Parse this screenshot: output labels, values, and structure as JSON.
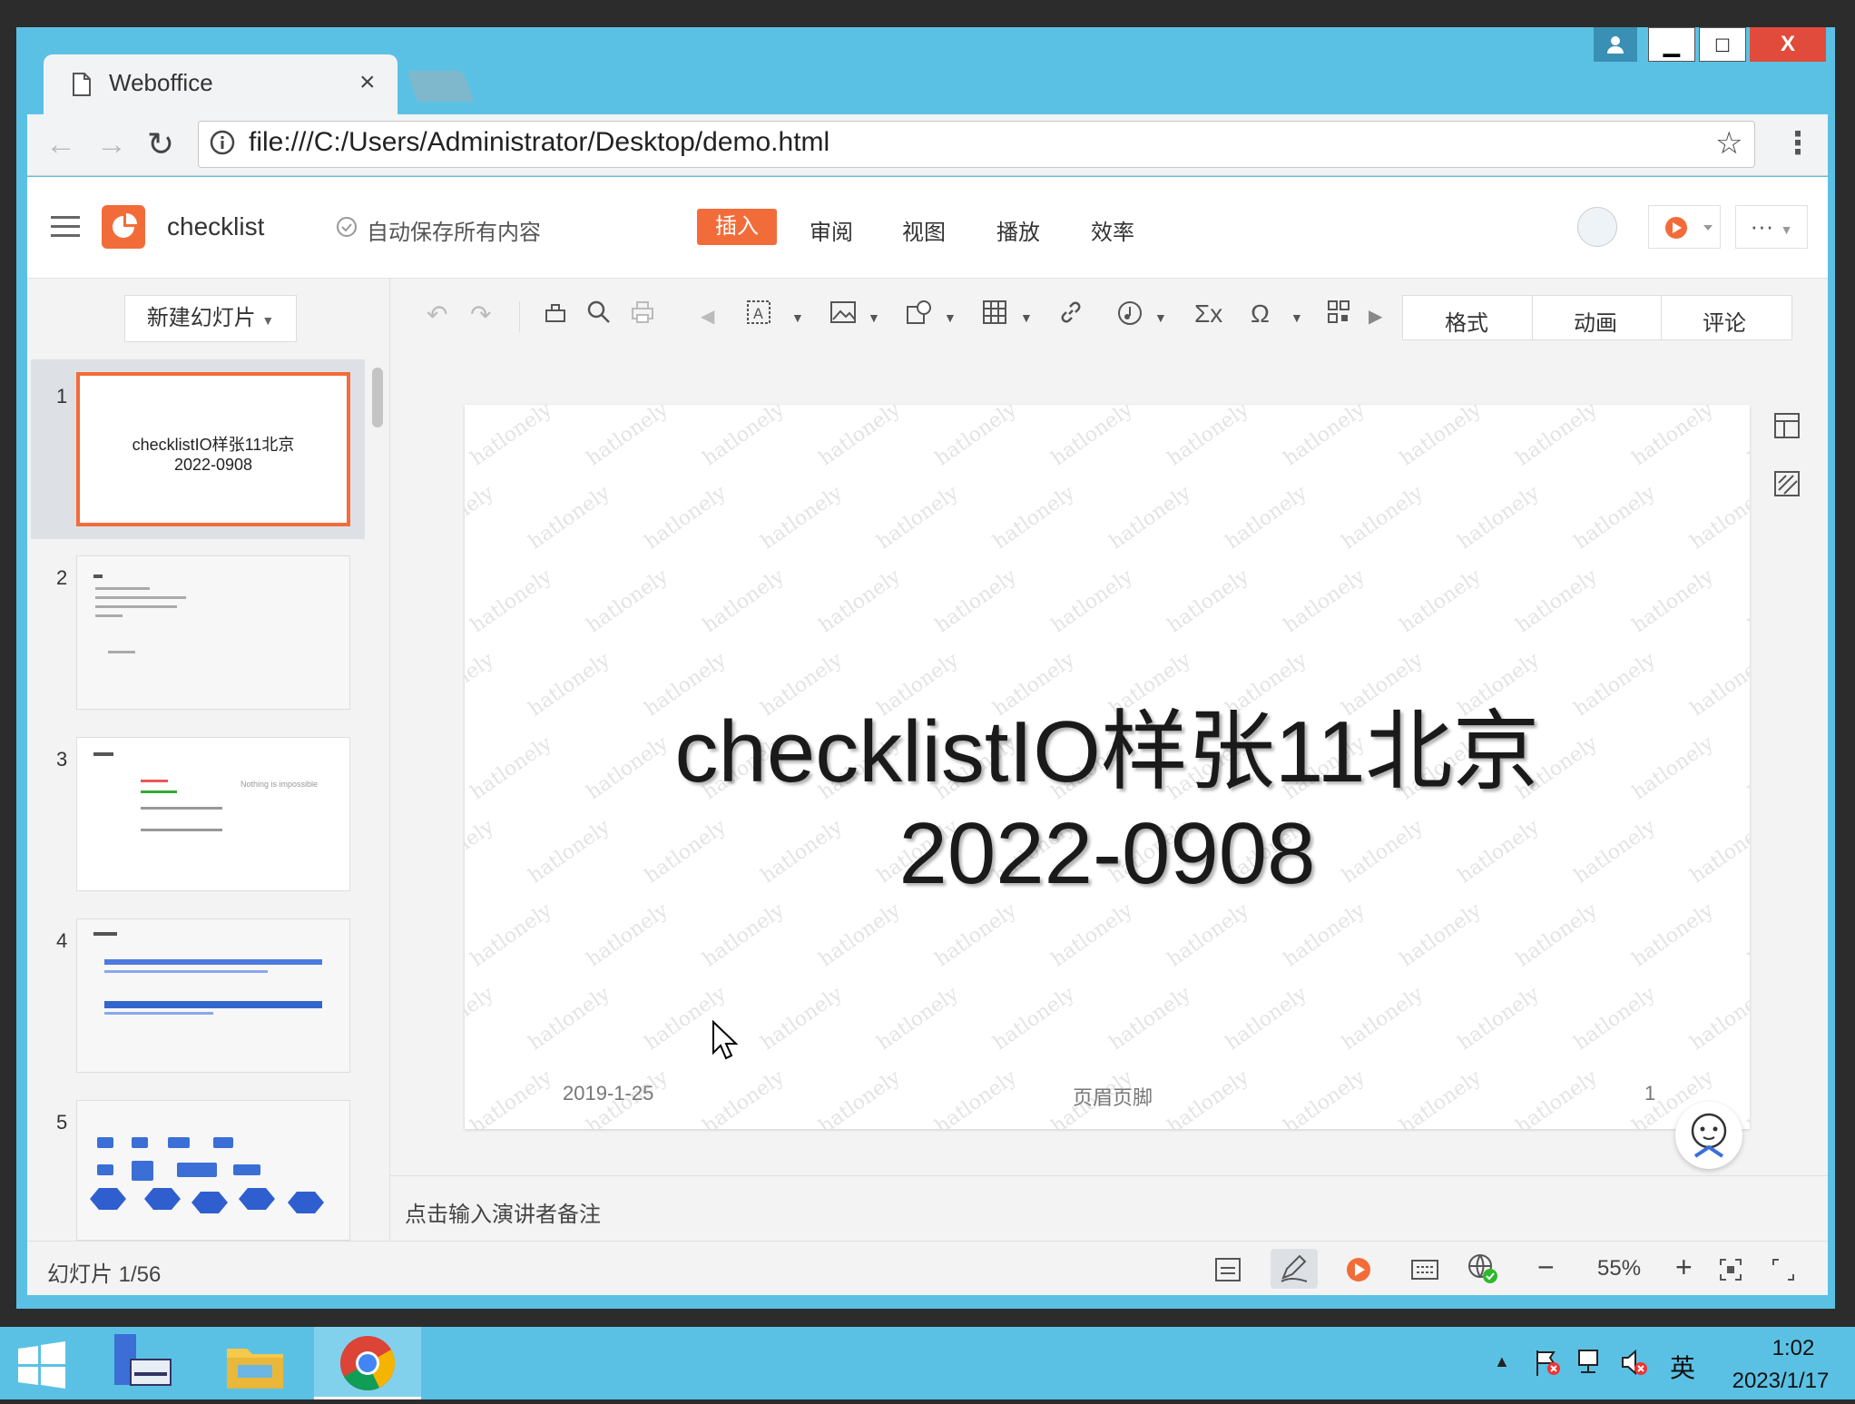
{
  "browser": {
    "tab_title": "Weboffice",
    "tab_close": "×",
    "url": "file:///C:/Users/Administrator/Desktop/demo.html"
  },
  "window_controls": {
    "minimize": "▁",
    "maximize": "□",
    "close": "X"
  },
  "app": {
    "doc_name": "checklist",
    "autosave": "自动保存所有内容",
    "menu": [
      "插入",
      "审阅",
      "视图",
      "播放",
      "效率"
    ],
    "more_label": "···",
    "right_tabs": [
      "格式",
      "动画",
      "评论"
    ]
  },
  "sidebar": {
    "new_slide_label": "新建幻灯片",
    "thumbs": [
      {
        "num": "1",
        "line1": "checklistIO样张11北京",
        "line2": "2022-0908"
      },
      {
        "num": "2"
      },
      {
        "num": "3",
        "text": "Nothing is impossible"
      },
      {
        "num": "4"
      },
      {
        "num": "5"
      }
    ]
  },
  "slide": {
    "title": "checklistIO样张11北京",
    "subtitle": "2022-0908",
    "footer_date": "2019-1-25",
    "footer_center": "页眉页脚",
    "page_num": "1",
    "watermark": "hatlonely"
  },
  "notes": {
    "placeholder": "点击输入演讲者备注"
  },
  "status": {
    "slide_counter": "幻灯片 1/56",
    "zoom": "55%"
  },
  "taskbar": {
    "time": "1:02",
    "date": "2023/1/17",
    "ime": "英"
  },
  "colors": {
    "accent": "#f26c3a",
    "chrome": "#5bc1e4"
  }
}
